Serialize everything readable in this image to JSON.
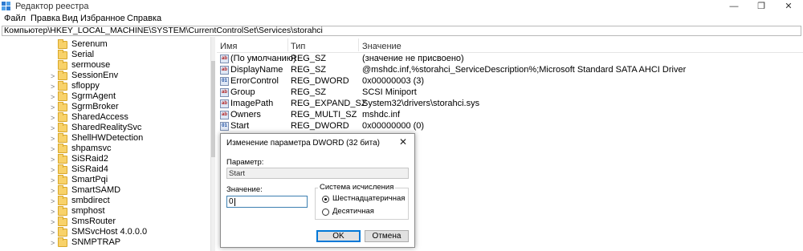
{
  "window": {
    "title": "Редактор реестра",
    "minimize": "—",
    "maximize": "❐",
    "close": "✕"
  },
  "menu": [
    "Файл",
    "Правка",
    "Вид",
    "Избранное",
    "Справка"
  ],
  "address": "Компьютер\\HKEY_LOCAL_MACHINE\\SYSTEM\\CurrentControlSet\\Services\\storahci",
  "tree": {
    "items": [
      {
        "label": "Serenum",
        "expandable": false
      },
      {
        "label": "Serial",
        "expandable": false
      },
      {
        "label": "sermouse",
        "expandable": false
      },
      {
        "label": "SessionEnv",
        "expandable": true
      },
      {
        "label": "sfloppy",
        "expandable": true
      },
      {
        "label": "SgrmAgent",
        "expandable": true
      },
      {
        "label": "SgrmBroker",
        "expandable": true
      },
      {
        "label": "SharedAccess",
        "expandable": true
      },
      {
        "label": "SharedRealitySvc",
        "expandable": true
      },
      {
        "label": "ShellHWDetection",
        "expandable": true
      },
      {
        "label": "shpamsvc",
        "expandable": true
      },
      {
        "label": "SiSRaid2",
        "expandable": true
      },
      {
        "label": "SiSRaid4",
        "expandable": true
      },
      {
        "label": "SmartPqi",
        "expandable": true
      },
      {
        "label": "SmartSAMD",
        "expandable": true
      },
      {
        "label": "smbdirect",
        "expandable": true
      },
      {
        "label": "smphost",
        "expandable": true
      },
      {
        "label": "SmsRouter",
        "expandable": true
      },
      {
        "label": "SMSvcHost 4.0.0.0",
        "expandable": true
      },
      {
        "label": "SNMPTRAP",
        "expandable": true
      }
    ]
  },
  "list": {
    "columns": [
      "Имя",
      "Тип",
      "Значение"
    ],
    "rows": [
      {
        "icon": "ab",
        "name": "(По умолчанию)",
        "type": "REG_SZ",
        "value": "(значение не присвоено)"
      },
      {
        "icon": "ab",
        "name": "DisplayName",
        "type": "REG_SZ",
        "value": "@mshdc.inf,%storahci_ServiceDescription%;Microsoft Standard SATA AHCI Driver"
      },
      {
        "icon": "dword",
        "name": "ErrorControl",
        "type": "REG_DWORD",
        "value": "0x00000003 (3)"
      },
      {
        "icon": "ab",
        "name": "Group",
        "type": "REG_SZ",
        "value": "SCSI Miniport"
      },
      {
        "icon": "ab",
        "name": "ImagePath",
        "type": "REG_EXPAND_SZ",
        "value": "System32\\drivers\\storahci.sys"
      },
      {
        "icon": "ab",
        "name": "Owners",
        "type": "REG_MULTI_SZ",
        "value": "mshdc.inf"
      },
      {
        "icon": "dword",
        "name": "Start",
        "type": "REG_DWORD",
        "value": "0x00000000 (0)"
      }
    ]
  },
  "dialog": {
    "title": "Изменение параметра DWORD (32 бита)",
    "close": "✕",
    "param_label": "Параметр:",
    "param_value": "Start",
    "value_label": "Значение:",
    "value_input": "0",
    "base_group_label": "Система исчисления",
    "radio_hex": "Шестнадцатеричная",
    "radio_dec": "Десятичная",
    "selected_base": "hex",
    "ok": "OK",
    "cancel": "Отмена"
  }
}
